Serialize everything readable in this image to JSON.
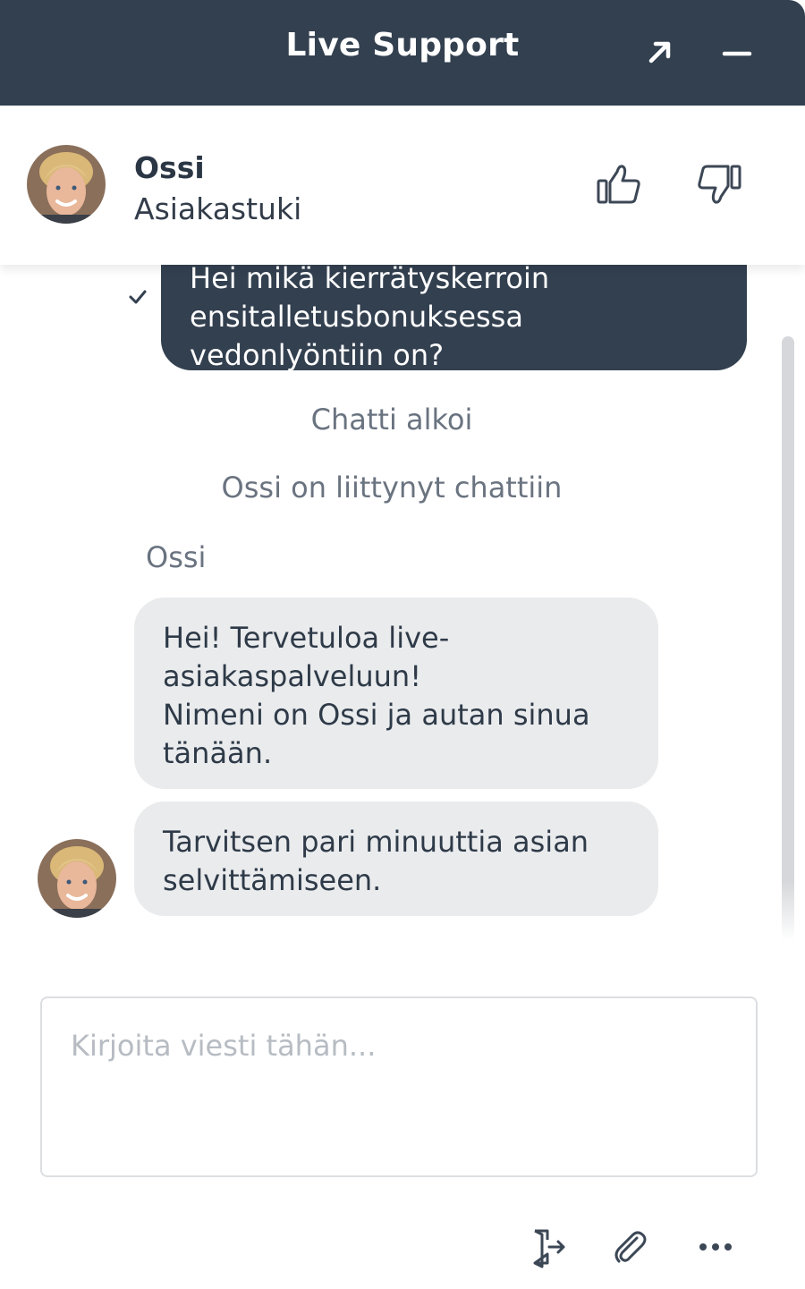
{
  "header": {
    "title": "Live Support",
    "icons": {
      "popout": "arrow-up-right-icon",
      "minimize": "minus-icon"
    }
  },
  "agent": {
    "name": "Ossi",
    "role": "Asiakastuki",
    "rating_icons": [
      "thumbs-up-icon",
      "thumbs-down-icon"
    ]
  },
  "conversation": {
    "user_message": "Hei mikä kierrätyskerroin ensitalletusbonuksessa vedonlyöntiin on?",
    "system_messages": [
      "Chatti alkoi",
      "Ossi on liittynyt chattiin"
    ],
    "sender_label": "Ossi",
    "agent_messages": [
      {
        "line1": "Hei! Tervetuloa live-asiakaspalveluun!",
        "line2": "Nimeni on Ossi ja autan sinua tänään."
      },
      {
        "line1": "Tarvitsen pari minuuttia asian selvittämiseen."
      }
    ]
  },
  "composer": {
    "placeholder": "Kirjoita viesti tähän...",
    "value": ""
  },
  "footer": {
    "icons": [
      "end-chat-icon",
      "paperclip-icon",
      "more-icon"
    ]
  },
  "colors": {
    "header_bg": "#334050",
    "user_bubble": "#334050",
    "agent_bubble": "#eaebed",
    "muted_text": "#6a7380"
  }
}
